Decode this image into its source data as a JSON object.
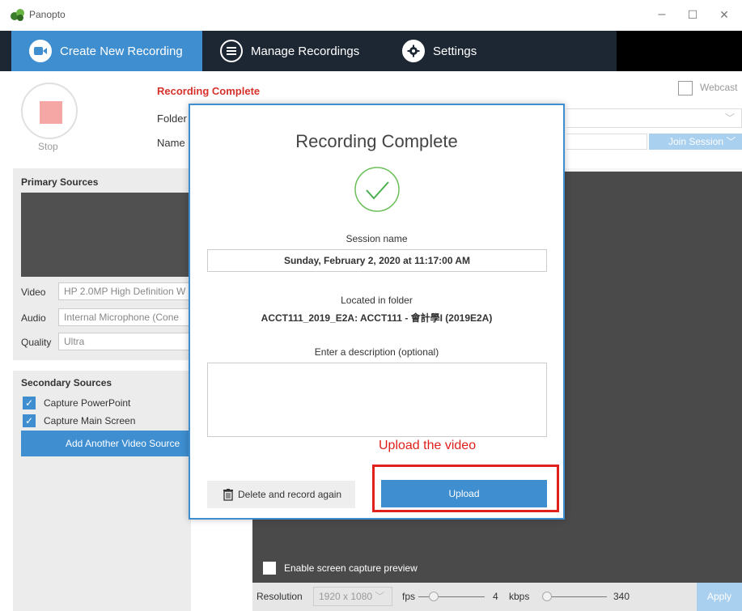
{
  "window": {
    "title": "Panopto",
    "minimize_glyph": "–",
    "maximize_glyph": "☐",
    "close_glyph": "✕"
  },
  "nav": {
    "tabs": [
      {
        "label": "Create New Recording",
        "icon": "video-camera-icon"
      },
      {
        "label": "Manage Recordings",
        "icon": "list-icon"
      },
      {
        "label": "Settings",
        "icon": "gear-icon"
      }
    ]
  },
  "recorder": {
    "stop_label": "Stop",
    "status": "Recording Complete",
    "folder_label": "Folder",
    "name_label": "Name",
    "join_session_label": "Join Session",
    "webcast_label": "Webcast"
  },
  "primary_sources": {
    "heading": "Primary Sources",
    "video_label": "Video",
    "video_value": "HP 2.0MP High Definition W",
    "audio_label": "Audio",
    "audio_value": "Internal Microphone (Cone",
    "quality_label": "Quality",
    "quality_value": "Ultra"
  },
  "secondary_sources": {
    "heading": "Secondary Sources",
    "capture_powerpoint": "Capture PowerPoint",
    "capture_main_screen": "Capture Main Screen",
    "add_video_source": "Add Another Video Source"
  },
  "screen_capture": {
    "enable_preview": "Enable screen capture preview",
    "resolution_label": "Resolution",
    "resolution_value": "1920 x 1080",
    "fps_label": "fps",
    "fps_value": "4",
    "kbps_label": "kbps",
    "kbps_value": "340",
    "apply_label": "Apply"
  },
  "modal": {
    "title": "Recording Complete",
    "session_name_label": "Session name",
    "session_name_value": "Sunday, February 2, 2020 at 11:17:00 AM",
    "folder_label": "Located in folder",
    "folder_value": "ACCT111_2019_E2A: ACCT111 - 會計學I (2019E2A)",
    "description_label": "Enter a description (optional)",
    "description_value": "",
    "annotation": "Upload the video",
    "delete_label": "Delete and record again",
    "upload_label": "Upload"
  },
  "colors": {
    "accent": "#3e8ed0",
    "nav_bg": "#1d2734",
    "status_red": "#d6312b",
    "annotation_red": "#e0201a",
    "check_green": "#4caf50"
  }
}
